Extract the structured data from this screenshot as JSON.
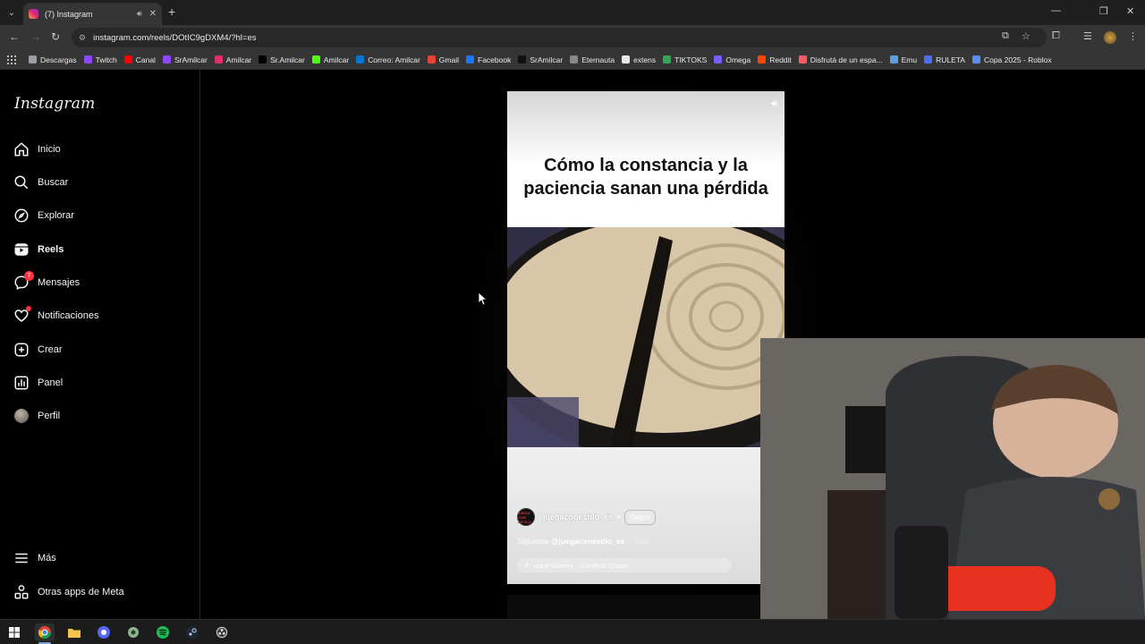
{
  "browser": {
    "tab_title": "(7) Instagram",
    "url": "instagram.com/reels/DOtIC9gDXM4/?hl=es",
    "bookmarks": [
      {
        "label": "Descargas",
        "color": "#9aa0a6"
      },
      {
        "label": "Twitch",
        "color": "#9146ff"
      },
      {
        "label": "Canal",
        "color": "#ff0000"
      },
      {
        "label": "SrAmilcar",
        "color": "#9146ff"
      },
      {
        "label": "Amilcar",
        "color": "#e1306c"
      },
      {
        "label": "Sr.Amilcar",
        "color": "#000000"
      },
      {
        "label": "Amilcar",
        "color": "#53fc18"
      },
      {
        "label": "Correo: Amilcar",
        "color": "#0078d4"
      },
      {
        "label": "Gmail",
        "color": "#ea4335"
      },
      {
        "label": "Facebook",
        "color": "#1877f2"
      },
      {
        "label": "SrAmilcar",
        "color": "#111111"
      },
      {
        "label": "Eternauta",
        "color": "#888888"
      },
      {
        "label": "extens",
        "color": "#e8e8e8"
      },
      {
        "label": "TIKTOKS",
        "color": "#34a853"
      },
      {
        "label": "Omega",
        "color": "#7b5cff"
      },
      {
        "label": "Reddit",
        "color": "#ff4500"
      },
      {
        "label": "Disfrutá de un espa...",
        "color": "#ff5a5f"
      },
      {
        "label": "Emu",
        "color": "#5aa0e0"
      },
      {
        "label": "RULETA",
        "color": "#4c6ef5"
      },
      {
        "label": "Copa 2025 - Roblox",
        "color": "#5b8def"
      }
    ]
  },
  "sidebar": {
    "logo": "Instagram",
    "items": [
      {
        "label": "Inicio",
        "icon": "home-icon"
      },
      {
        "label": "Buscar",
        "icon": "search-icon"
      },
      {
        "label": "Explorar",
        "icon": "compass-icon"
      },
      {
        "label": "Reels",
        "icon": "reels-icon"
      },
      {
        "label": "Mensajes",
        "icon": "messenger-icon",
        "badge": "7"
      },
      {
        "label": "Notificaciones",
        "icon": "heart-icon"
      },
      {
        "label": "Crear",
        "icon": "plus-square-icon"
      },
      {
        "label": "Panel",
        "icon": "chart-icon"
      },
      {
        "label": "Perfil",
        "icon": "avatar"
      }
    ],
    "more_label": "Más",
    "meta_label": "Otras apps de Meta"
  },
  "reel": {
    "caption_text": "Cómo la constancia y la paciencia sanan una pérdida",
    "author": "juegaconestilo_es",
    "separator": "•",
    "follow_label": "Seguir",
    "description_prefix": "Síguenos",
    "description_handle": "@juegaconestilo_es",
    "description_more": "... más",
    "audio": "Hans Zimmer · Cornfield Chase",
    "avatar_text": "JUEGA CON ESTILO"
  },
  "colors": {
    "accent_badge": "#ff3040",
    "ig_background": "#000000",
    "browser_chrome": "#353535"
  }
}
